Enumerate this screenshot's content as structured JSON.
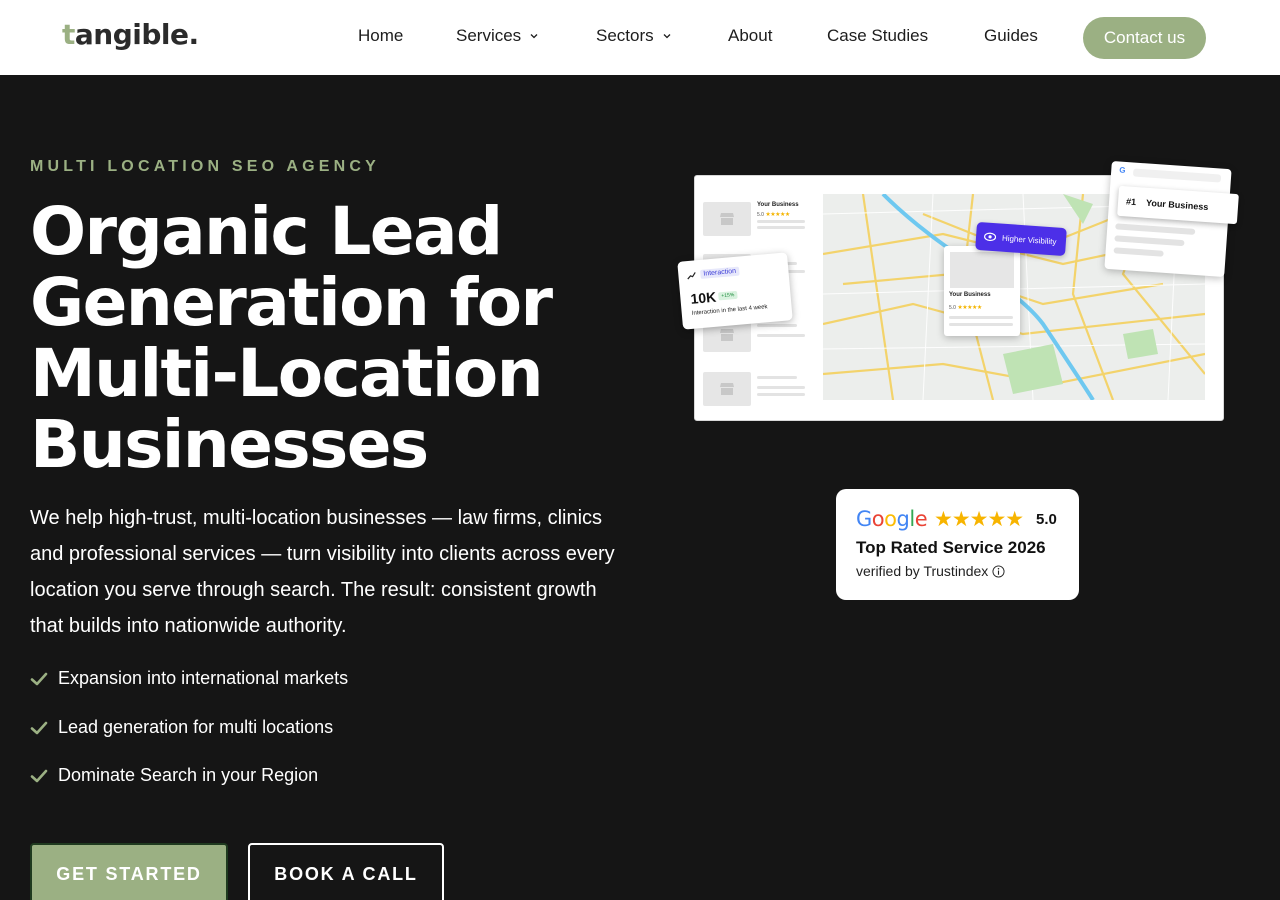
{
  "brand": {
    "logo_initial": "t",
    "logo_rest": "angible.",
    "accent": "#9bb083"
  },
  "nav": {
    "home": "Home",
    "services": "Services",
    "sectors": "Sectors",
    "about": "About",
    "case_studies": "Case Studies",
    "guides": "Guides",
    "contact": "Contact us"
  },
  "hero": {
    "eyebrow": "MULTI LOCATION SEO AGENCY",
    "headline": [
      "Organic Lead",
      "Generation for",
      "Multi-Location",
      "Businesses"
    ],
    "lead": "We help high-trust, multi-location businesses — law firms, clinics and professional services — turn visibility into clients across every location you serve through search. The result: consistent growth that builds into nationwide authority.",
    "bullets": [
      "Expansion into international markets",
      "Lead generation for multi locations",
      "Dominate Search in your Region"
    ],
    "cta_primary": "GET STARTED",
    "cta_secondary": "BOOK A CALL"
  },
  "illustration": {
    "your_business": "Your Business",
    "rating": "5.0",
    "higher_visibility": "Higher Visibility",
    "interaction_label": "Interaction",
    "interaction_value": "10K",
    "interaction_pill": "+15%",
    "interaction_sub": "Interaction in the last 4 week",
    "rank": "#1",
    "rank_business": "Your Business",
    "serp_logo": "G"
  },
  "review": {
    "google": "Google",
    "stars": "★★★★★",
    "score": "5.0",
    "title": "Top Rated Service 2026",
    "verified": "verified by Trustindex"
  }
}
